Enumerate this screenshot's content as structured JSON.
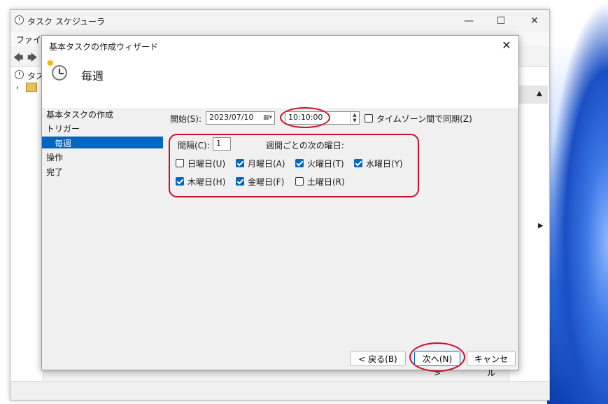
{
  "main_window": {
    "title": "タスク スケジューラ",
    "menu_file": "ファイル",
    "tree_label": "タス"
  },
  "dialog": {
    "title": "基本タスクの作成ウィザード",
    "header_title": "毎週",
    "nav": {
      "create": "基本タスクの作成",
      "trigger": "トリガー",
      "weekly": "毎週",
      "action": "操作",
      "finish": "完了"
    },
    "start_label": "開始(S):",
    "start_date": "2023/07/10",
    "start_time": "10:10:00",
    "sync_timezone_label": "タイムゾーン間で同期(Z)",
    "sync_timezone_checked": false,
    "interval_label": "間隔(C):",
    "interval_value": "1",
    "weekday_caption": "週間ごとの次の曜日:",
    "days": [
      {
        "label": "日曜日(U)",
        "checked": false
      },
      {
        "label": "月曜日(A)",
        "checked": true
      },
      {
        "label": "火曜日(T)",
        "checked": true
      },
      {
        "label": "水曜日(Y)",
        "checked": true
      },
      {
        "label": "木曜日(H)",
        "checked": true
      },
      {
        "label": "金曜日(F)",
        "checked": true
      },
      {
        "label": "土曜日(R)",
        "checked": false
      }
    ],
    "buttons": {
      "back": "< 戻る(B)",
      "next": "次へ(N) >",
      "cancel": "キャンセル"
    }
  },
  "colors": {
    "accent": "#0067c0",
    "annotation": "#c8102e"
  }
}
